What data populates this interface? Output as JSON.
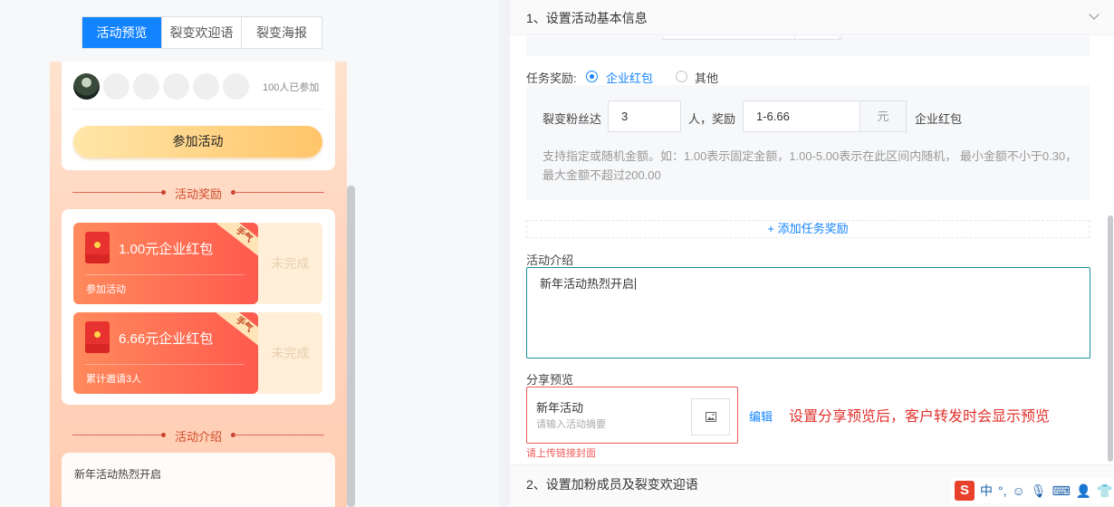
{
  "preview": {
    "tabs": [
      {
        "label": "活动预览",
        "active": true
      },
      {
        "label": "裂变欢迎语",
        "active": false
      },
      {
        "label": "裂变海报",
        "active": false
      }
    ],
    "joined_count": "100人已参加",
    "join_button": "参加活动",
    "rewards_title": "活动奖励",
    "rewards": [
      {
        "amount": "1.00元企业红包",
        "condition": "参加活动",
        "ribbon": "手气",
        "status": "未完成"
      },
      {
        "amount": "6.66元企业红包",
        "condition": "累计邀请3人",
        "ribbon": "手气",
        "status": "未完成"
      }
    ],
    "intro_title": "活动介绍",
    "intro_text": "新年活动热烈开启"
  },
  "settings": {
    "step1_title": "1、设置活动基本信息",
    "task_reward_label": "任务奖励:",
    "reward_options": [
      {
        "label": "企业红包",
        "selected": true
      },
      {
        "label": "其他",
        "selected": false
      }
    ],
    "rule": {
      "prefix": "裂变粉丝达",
      "people_value": "3",
      "mid": "人，奖励",
      "amount_value": "1-6.66",
      "unit": "元",
      "suffix": "企业红包"
    },
    "hint": "支持指定或随机金额。如：1.00表示固定金额，1.00-5.00表示在此区间内随机， 最小金额不小于0.30，最大金额不超过200.00",
    "add_task": "+ 添加任务奖励",
    "intro_label": "活动介绍",
    "intro_value": "新年活动热烈开启",
    "share_label": "分享预览",
    "share_title": "新年活动",
    "share_summary_placeholder": "请输入活动摘要",
    "edit_link": "编辑",
    "share_note": "设置分享预览后，客户转发时会显示预览",
    "share_error": "请上传链接封面",
    "step2_title": "2、设置加粉成员及裂变欢迎语"
  },
  "ime": {
    "logo": "S",
    "mode": "中",
    "punct": "°,"
  },
  "colors": {
    "accent": "#1384ff",
    "error": "#e0312c",
    "reward_gradient_start": "#ff8a5c",
    "reward_gradient_end": "#ff5a4e"
  }
}
